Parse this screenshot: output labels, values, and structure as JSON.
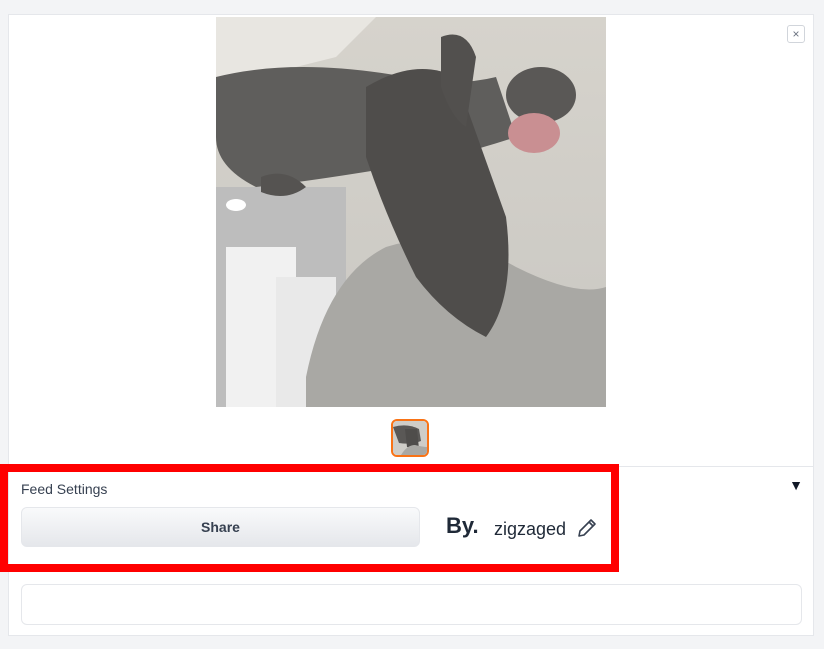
{
  "gallery": {
    "close_label": "×"
  },
  "settings": {
    "section_label": "Feed Settings",
    "share_label": "Share",
    "by_label": "By.",
    "username": "zigzaged",
    "collapse_glyph": "▼"
  },
  "prompt_field": {
    "value": "",
    "placeholder": ""
  },
  "colors": {
    "highlight": "#ff0000",
    "thumb_border": "#f97316"
  }
}
